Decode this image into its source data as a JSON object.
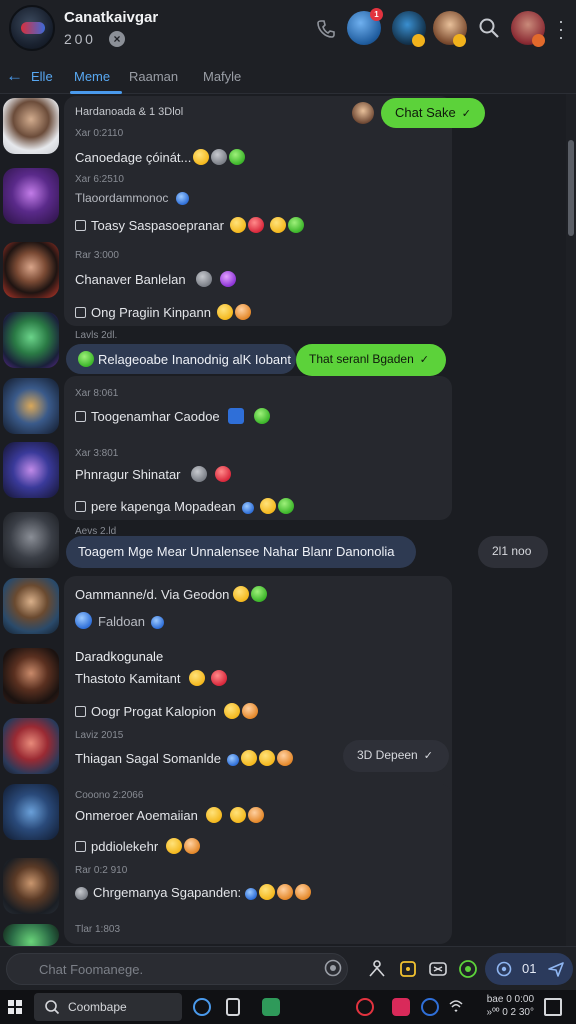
{
  "header": {
    "title": "Canatkaivgar",
    "subtitle": "2 0 0",
    "status_badge": "1"
  },
  "nav": {
    "back_label": "Elle",
    "tabs": [
      "Meme",
      "Raaman",
      "Mafyle"
    ],
    "active_tab": "Meme"
  },
  "conversations": [
    {
      "meta": "Hardanoada & 1 3Dlol",
      "name": "",
      "line1": "Canoedage çóinát...",
      "line1_meta": "Xar 0:2110",
      "line2": "",
      "pill": "Chat Sake"
    },
    {
      "meta": "Xar 6:2510",
      "name": "Tlaoordammonoc",
      "line1": "",
      "line2": "Toasy Saspasoepranar"
    },
    {
      "meta": "Rar 3:000",
      "name": "Chanaver Banlelan",
      "line1": "",
      "line2": "Ong Pragiin Kinpann"
    },
    {
      "meta": "Lavls 2dl.",
      "line1": "Relageoabe Inanodnig alK Iobant",
      "pill": "That seranl Bgaden"
    },
    {
      "meta": "Xar 8:061",
      "line1": "Toogenamhar Caodoe"
    },
    {
      "meta": "Xar 3:801",
      "name": "Phnragur Shinatar",
      "line2": "pere kapenga Mopadean"
    },
    {
      "meta": "Aevs 2.ld",
      "line1": "Toagem Mge Mear Unnalensee Nahar Blanr Danonolia",
      "pill": "2l1 noo"
    },
    {
      "name": "Oammanne/d. Via Geodon",
      "line2": "Faldoan"
    },
    {
      "name": "Daradkogunale",
      "line1": "Thastoto Kamitant",
      "line2": "Oogr Progat Kalopion"
    },
    {
      "meta": "Laviz 2015",
      "line1": "Thiagan Sagal Somanlde",
      "pill": "3D Depeen"
    },
    {
      "meta": "Cooono 2:2066",
      "name": "Onmeroer Aoemaiian",
      "line2": "pddiolekehr"
    },
    {
      "meta": "Rar 0:2 910",
      "line1": "Chrgemanya Sgapanden:"
    },
    {
      "meta": "Tlar 1:803"
    }
  ],
  "composer": {
    "placeholder": "Chat Foomanege.",
    "send_count": "01"
  },
  "taskbar": {
    "search_label": "Coombape",
    "time": "bae 0 0:00",
    "date": "»ºº 0 2 30°"
  },
  "colors": {
    "accent": "#4a9aec",
    "green": "#5cd23a",
    "panel": "#26282e",
    "background": "#1b1d22"
  }
}
